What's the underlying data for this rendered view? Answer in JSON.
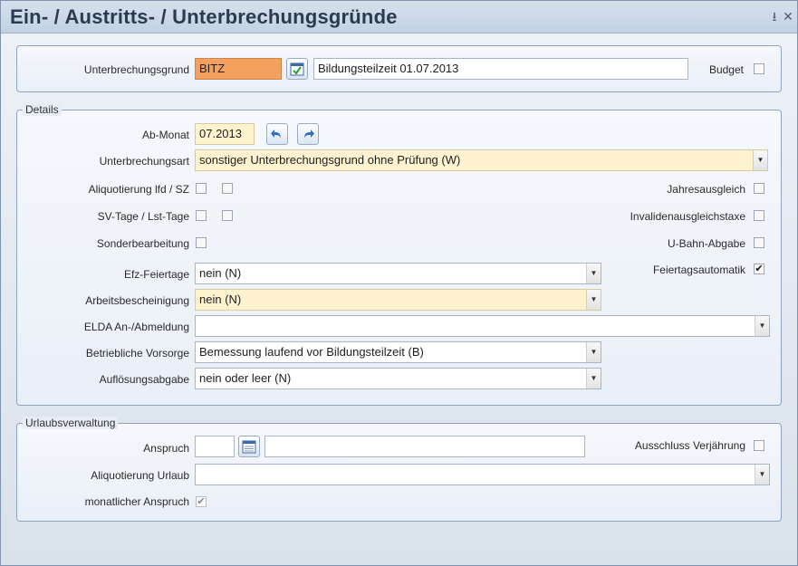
{
  "window": {
    "title": "Ein- / Austritts- / Unterbrechungsgründe",
    "minimize_glyph": "⭳",
    "close_glyph": "✕"
  },
  "header_group": {
    "reason_label": "Unterbrechungsgrund",
    "reason_code": "BITZ",
    "reason_text": "Bildungsteilzeit 01.07.2013",
    "budget_label": "Budget",
    "budget_checked": false
  },
  "details": {
    "legend": "Details",
    "ab_monat_label": "Ab-Monat",
    "ab_monat_value": "07.2013",
    "art_label": "Unterbrechungsart",
    "art_value": "sonstiger Unterbrechungsgrund ohne Prüfung (W)",
    "aliquot_label": "Aliquotierung lfd / SZ",
    "svtage_label": "SV-Tage / Lst-Tage",
    "sonder_label": "Sonderbearbeitung",
    "jahres_label": "Jahresausgleich",
    "invaliden_label": "Invalidenausgleichstaxe",
    "ubahn_label": "U-Bahn-Abgabe",
    "feiertag_label": "Feiertagsautomatik",
    "feiertag_checked": true,
    "efz_label": "Efz-Feiertage",
    "efz_value": "nein (N)",
    "arbeits_label": "Arbeitsbescheinigung",
    "arbeits_value": "nein (N)",
    "elda_label": "ELDA An-/Abmeldung",
    "elda_value": "",
    "vorsorge_label": "Betriebliche Vorsorge",
    "vorsorge_value": "Bemessung laufend vor Bildungsteilzeit (B)",
    "aufloesung_label": "Auflösungsabgabe",
    "aufloesung_value": "nein oder leer (N)"
  },
  "urlaub": {
    "legend": "Urlaubsverwaltung",
    "anspruch_label": "Anspruch",
    "anspruch_value": "",
    "anspruch_text": "",
    "ausschluss_label": "Ausschluss Verjährung",
    "aliquot_label": "Aliquotierung Urlaub",
    "aliquot_value": "",
    "monatlich_label": "monatlicher Anspruch",
    "monatlich_checked": true
  },
  "colors": {
    "accent_orange": "#f5a15e",
    "highlight_yellow": "#fff3cf",
    "frame_blue": "#8ea4c2"
  },
  "icons": {
    "calendar_check": "calendar-check-icon",
    "calendar": "calendar-icon",
    "undo": "undo-arrow-icon",
    "redo": "redo-arrow-icon",
    "check": "✔"
  }
}
